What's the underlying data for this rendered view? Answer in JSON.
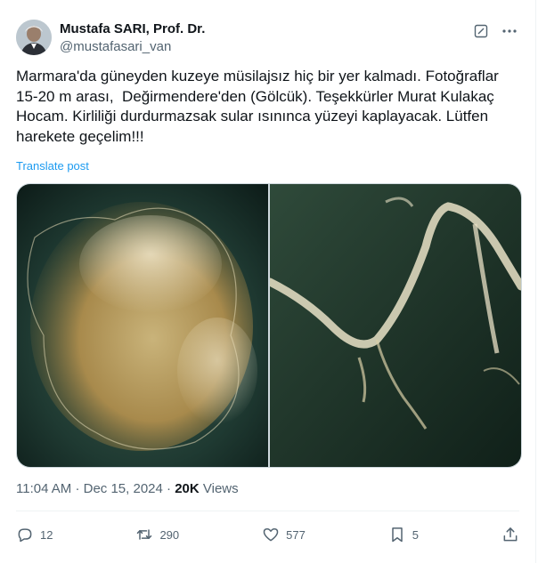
{
  "author": {
    "display_name": "Mustafa SARI, Prof. Dr.",
    "handle": "@mustafasari_van"
  },
  "post": {
    "text": "Marmara'da güneyden kuzeye müsilajsız hiç bir yer kalmadı. Fotoğraflar 15-20 m arası,  Değirmendere'den (Gölcük). Teşekkürler Murat Kulakaç Hocam. Kirliliği durdurmazsak sular ısınınca yüzeyi kaplayacak. Lütfen harekete geçelim!!!",
    "translate_label": "Translate post"
  },
  "meta": {
    "time": "11:04 AM",
    "separator1": "·",
    "date": "Dec 15, 2024",
    "separator2": "·",
    "views_count": "20K",
    "views_label": "Views"
  },
  "actions": {
    "replies": "12",
    "reposts": "290",
    "likes": "577",
    "bookmarks": "5"
  },
  "icons": {
    "edit": "edit-icon",
    "more": "more-icon",
    "reply": "reply-icon",
    "repost": "repost-icon",
    "like": "heart-icon",
    "bookmark": "bookmark-icon",
    "share": "share-icon"
  },
  "colors": {
    "link": "#1d9bf0",
    "secondary_text": "#536471",
    "primary_text": "#0f1419"
  }
}
